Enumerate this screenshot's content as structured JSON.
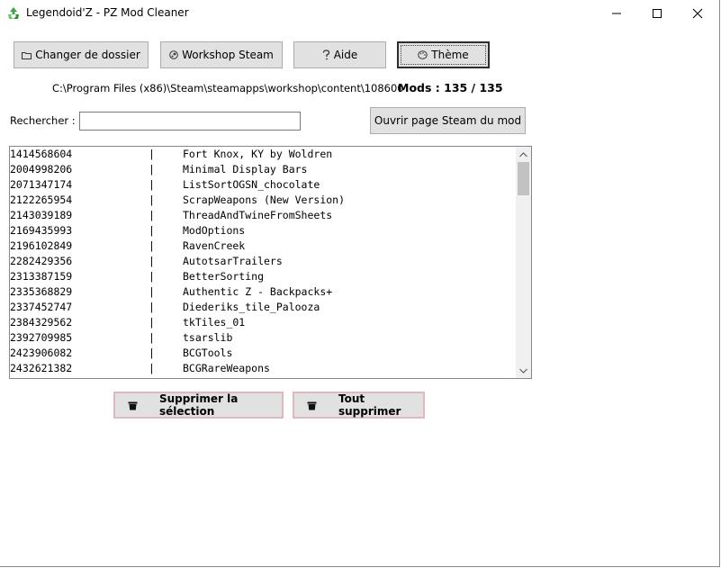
{
  "window": {
    "title": "Legendoid'Z - PZ Mod Cleaner"
  },
  "toolbar": {
    "change_folder_label": "Changer de dossier",
    "workshop_label": "Workshop Steam",
    "help_label": "Aide",
    "theme_label": "Thème"
  },
  "folder": {
    "path": "C:\\Program Files (x86)\\Steam\\steamapps\\workshop\\content\\108600",
    "mods_count": "Mods : 135 / 135"
  },
  "search": {
    "label": "Rechercher :",
    "value": "",
    "open_steam_label": "Ouvrir page Steam du mod"
  },
  "mods": {
    "separator": "|",
    "rows": [
      {
        "id": "1414568604",
        "name": "Fort Knox, KY by Woldren"
      },
      {
        "id": "2004998206",
        "name": "Minimal Display Bars"
      },
      {
        "id": "2071347174",
        "name": "ListSortOGSN_chocolate"
      },
      {
        "id": "2122265954",
        "name": "ScrapWeapons (New Version)"
      },
      {
        "id": "2143039189",
        "name": "ThreadAndTwineFromSheets"
      },
      {
        "id": "2169435993",
        "name": "ModOptions"
      },
      {
        "id": "2196102849",
        "name": "RavenCreek"
      },
      {
        "id": "2282429356",
        "name": "AutotsarTrailers"
      },
      {
        "id": "2313387159",
        "name": "BetterSorting"
      },
      {
        "id": "2335368829",
        "name": "Authentic Z - Backpacks+"
      },
      {
        "id": "2337452747",
        "name": "Diederiks_tile_Palooza"
      },
      {
        "id": "2384329562",
        "name": "tkTiles_01"
      },
      {
        "id": "2392709985",
        "name": "tsarslib"
      },
      {
        "id": "2423906082",
        "name": "BCGTools"
      },
      {
        "id": "2432621382",
        "name": "BCGRareWeapons"
      }
    ]
  },
  "actions": {
    "delete_selection_label": "Supprimer la sélection",
    "delete_all_label": "Tout supprimer"
  },
  "icons": {
    "app": "recycle-icon",
    "folder": "folder-icon",
    "workshop": "steam-icon",
    "help": "question-icon",
    "theme": "palette-icon",
    "trash": "trash-icon"
  },
  "colors": {
    "button_bg": "#e1e1e1",
    "danger_border": "#e0b8bd",
    "app_icon_green": "#4caf50"
  }
}
